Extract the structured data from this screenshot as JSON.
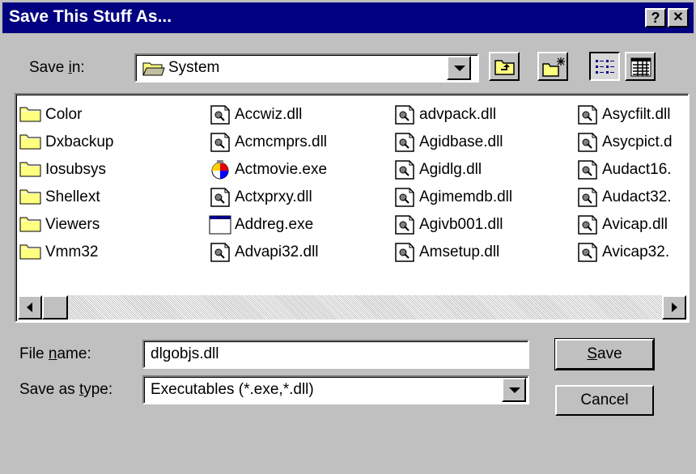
{
  "dialog": {
    "title": "Save This Stuff As...",
    "help_button": "?",
    "close_button": "✕"
  },
  "save_in": {
    "label_pre": "Save ",
    "label_key": "i",
    "label_post": "n:",
    "value": "System"
  },
  "files": [
    {
      "name": "Color",
      "icon": "folder-icon"
    },
    {
      "name": "Dxbackup",
      "icon": "folder-icon"
    },
    {
      "name": "Iosubsys",
      "icon": "folder-icon"
    },
    {
      "name": "Shellext",
      "icon": "folder-icon"
    },
    {
      "name": "Viewers",
      "icon": "folder-icon"
    },
    {
      "name": "Vmm32",
      "icon": "folder-icon"
    },
    {
      "name": "Accwiz.dll",
      "icon": "dll-file-icon"
    },
    {
      "name": "Acmcmprs.dll",
      "icon": "dll-file-icon"
    },
    {
      "name": "Actmovie.exe",
      "icon": "actmovie-exe-icon"
    },
    {
      "name": "Actxprxy.dll",
      "icon": "dll-file-icon"
    },
    {
      "name": "Addreg.exe",
      "icon": "window-exe-icon"
    },
    {
      "name": "Advapi32.dll",
      "icon": "dll-file-icon"
    },
    {
      "name": "advpack.dll",
      "icon": "dll-file-icon"
    },
    {
      "name": "Agidbase.dll",
      "icon": "dll-file-icon"
    },
    {
      "name": "Agidlg.dll",
      "icon": "dll-file-icon"
    },
    {
      "name": "Agimemdb.dll",
      "icon": "dll-file-icon"
    },
    {
      "name": "Agivb001.dll",
      "icon": "dll-file-icon"
    },
    {
      "name": "Amsetup.dll",
      "icon": "dll-file-icon"
    },
    {
      "name": "Asycfilt.dll",
      "icon": "dll-file-icon"
    },
    {
      "name": "Asycpict.d",
      "icon": "dll-file-icon"
    },
    {
      "name": "Audact16.",
      "icon": "dll-file-icon"
    },
    {
      "name": "Audact32.",
      "icon": "dll-file-icon"
    },
    {
      "name": "Avicap.dll",
      "icon": "dll-file-icon"
    },
    {
      "name": "Avicap32. ",
      "icon": "dll-file-icon"
    }
  ],
  "file_name": {
    "label_pre": "File ",
    "label_key": "n",
    "label_post": "ame:",
    "value": "dlgobjs.dll"
  },
  "save_type": {
    "label_pre": "Save as ",
    "label_key": "t",
    "label_post": "ype:",
    "value": "Executables (*.exe,*.dll)"
  },
  "buttons": {
    "save_key": "S",
    "save_rest": "ave",
    "cancel": "Cancel"
  },
  "colors": {
    "title_bar": "#000080",
    "face": "#c0c0c0",
    "folder": "#ffff80"
  }
}
